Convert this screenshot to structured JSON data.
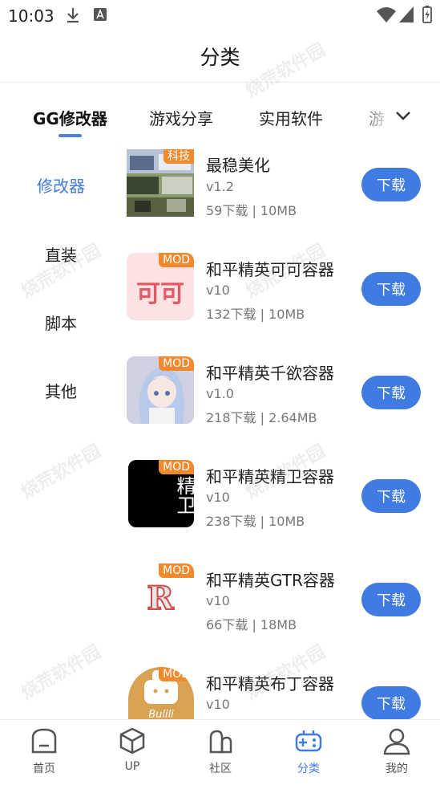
{
  "status": {
    "time": "10:03"
  },
  "header": {
    "title": "分类"
  },
  "tabs": [
    {
      "label": "GG修改器"
    },
    {
      "label": "游戏分享"
    },
    {
      "label": "实用软件"
    },
    {
      "label": "游"
    }
  ],
  "sidebar": {
    "items": [
      {
        "label": "修改器"
      },
      {
        "label": "直装"
      },
      {
        "label": "脚本"
      },
      {
        "label": "其他"
      }
    ]
  },
  "apps": [
    {
      "badge": "科技",
      "name": "最稳美化",
      "version": "v1.2",
      "stats": "59下载 | 10MB",
      "download": "下载"
    },
    {
      "badge": "MOD",
      "name": "和平精英可可容器",
      "version": "v10",
      "stats": "132下载 | 10MB",
      "download": "下载"
    },
    {
      "badge": "MOD",
      "name": "和平精英千欲容器",
      "version": "v1.0",
      "stats": "218下载 | 2.64MB",
      "download": "下载"
    },
    {
      "badge": "MOD",
      "name": "和平精英精卫容器",
      "version": "v10",
      "stats": "238下载 | 10MB",
      "download": "下载"
    },
    {
      "badge": "MOD",
      "name": "和平精英GTR容器",
      "version": "v10",
      "stats": "66下载 | 18MB",
      "download": "下载"
    },
    {
      "badge": "MOD",
      "name": "和平精英布丁容器",
      "version": "v10",
      "stats": "",
      "download": "下载"
    }
  ],
  "thumbs": {
    "keke": "可可",
    "jingwei": "精卫",
    "gtr": "R",
    "buding": "Bulili"
  },
  "bottom_nav": [
    {
      "label": "首页",
      "icon": "home-icon"
    },
    {
      "label": "UP",
      "icon": "cube-icon"
    },
    {
      "label": "社区",
      "icon": "community-icon"
    },
    {
      "label": "分类",
      "icon": "gamepad-icon"
    },
    {
      "label": "我的",
      "icon": "user-icon"
    }
  ],
  "watermark": "烧荒软件园",
  "colors": {
    "accent": "#3f7be0",
    "badge": "#f08a2e"
  }
}
